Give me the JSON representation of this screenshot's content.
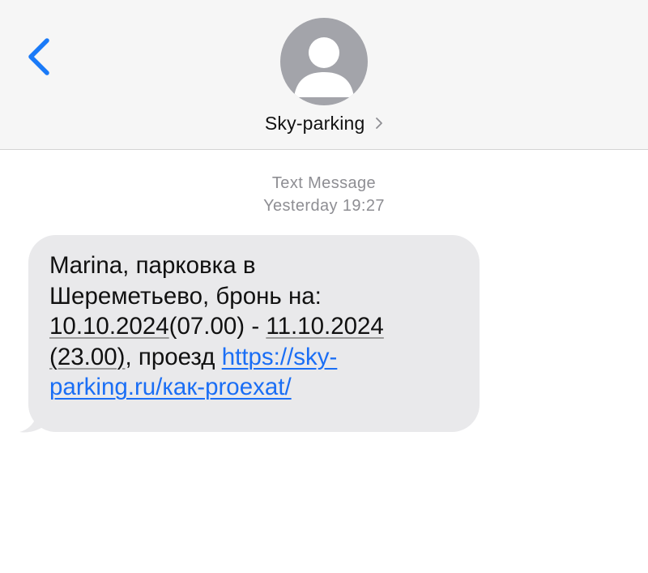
{
  "header": {
    "back_icon": "chevron-left-icon",
    "avatar_icon": "person-silhouette-icon",
    "contact_name": "Sky-parking",
    "contact_chevron_icon": "chevron-right-icon"
  },
  "thread": {
    "service_label": "Text Message",
    "timestamp": "Yesterday 19:27"
  },
  "message": {
    "line1": "Marina, парковка в",
    "line2": "Шереметьево, бронь на:",
    "start_date": "10.10.2024",
    "start_time": "(07.00)",
    "separator": " - ",
    "end_date": "11.10.2024",
    "end_time": "(23.00)",
    "mid_text": ", проезд ",
    "link_part1": "https://sky-",
    "link_part2": "parking.ru/как-proexat/"
  },
  "colors": {
    "header_bg": "#f6f6f6",
    "accent": "#1a7af8",
    "bubble_bg": "#e9e9eb",
    "meta_text": "#8e8e93",
    "link": "#1a6ef5",
    "avatar_bg": "#a3a4aa"
  }
}
